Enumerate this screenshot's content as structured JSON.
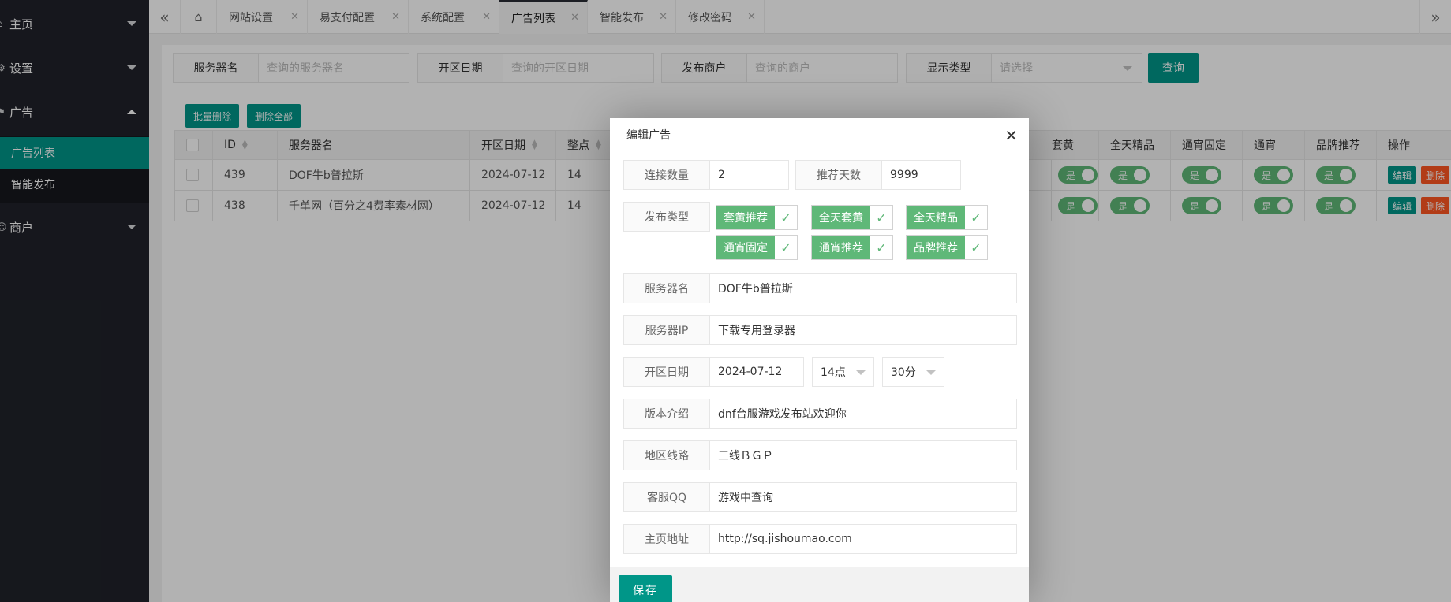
{
  "sidebar": {
    "items": [
      {
        "label": "主页"
      },
      {
        "label": "设置"
      },
      {
        "label": "广告"
      },
      {
        "label": "商户"
      }
    ],
    "sub_items": [
      {
        "label": "广告列表"
      },
      {
        "label": "智能发布"
      }
    ]
  },
  "tabs": [
    {
      "label": "网站设置"
    },
    {
      "label": "易支付配置"
    },
    {
      "label": "系统配置"
    },
    {
      "label": "广告列表"
    },
    {
      "label": "智能发布"
    },
    {
      "label": "修改密码"
    }
  ],
  "search": {
    "fields": [
      {
        "label": "服务器名",
        "placeholder": "查询的服务器名"
      },
      {
        "label": "开区日期",
        "placeholder": "查询的开区日期"
      },
      {
        "label": "发布商户",
        "placeholder": "查询的商户"
      },
      {
        "label": "显示类型",
        "placeholder": "请选择"
      }
    ],
    "query_label": "查询"
  },
  "toolbar": {
    "batch_delete_label": "批量删除",
    "delete_all_label": "删除全部"
  },
  "table": {
    "headers": [
      "ID",
      "服务器名",
      "开区日期",
      "整点",
      "套黄",
      "全天精品",
      "通宵固定",
      "通宵",
      "品牌推荐",
      "操作"
    ],
    "rows": [
      {
        "id": "439",
        "name": "DOF牛b普拉斯",
        "date": "2024-07-12",
        "hour": "14"
      },
      {
        "id": "438",
        "name": "千单网（百分之4费率素材网）",
        "date": "2024-07-12",
        "hour": "14"
      }
    ],
    "switch_label": "是",
    "edit_label": "编辑",
    "delete_label": "删除"
  },
  "modal": {
    "title": "编辑广告",
    "connect_count_label": "连接数量",
    "connect_count_value": "2",
    "recommend_days_label": "推荐天数",
    "recommend_days_value": "9999",
    "publish_type_label": "发布类型",
    "publish_types": [
      "套黄推荐",
      "全天套黄",
      "全天精品",
      "通宵固定",
      "通宵推荐",
      "品牌推荐"
    ],
    "server_name_label": "服务器名",
    "server_name_value": "DOF牛b普拉斯",
    "server_ip_label": "服务器IP",
    "server_ip_value": "下载专用登录器",
    "open_date_label": "开区日期",
    "open_date_value": "2024-07-12",
    "hour_value": "14点",
    "minute_value": "30分",
    "version_label": "版本介绍",
    "version_value": "dnf台服游戏发布站欢迎你",
    "region_label": "地区线路",
    "region_value": "三线ＢＧＰ",
    "qq_label": "客服QQ",
    "qq_value": "游戏中查询",
    "homepage_label": "主页地址",
    "homepage_value": "http://sq.jishoumao.com",
    "save_label": "保存"
  }
}
